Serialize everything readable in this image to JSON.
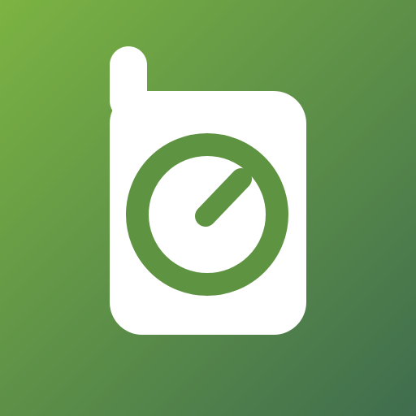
{
  "icon": {
    "name": "baby-monitor-app-icon",
    "glyph": "walkie-talkie-with-dial",
    "colors": {
      "background_top_left": "#7cb342",
      "background_bottom_right": "#3f6d4e",
      "device_fill": "#ffffff",
      "dial": "#5e9342"
    }
  }
}
